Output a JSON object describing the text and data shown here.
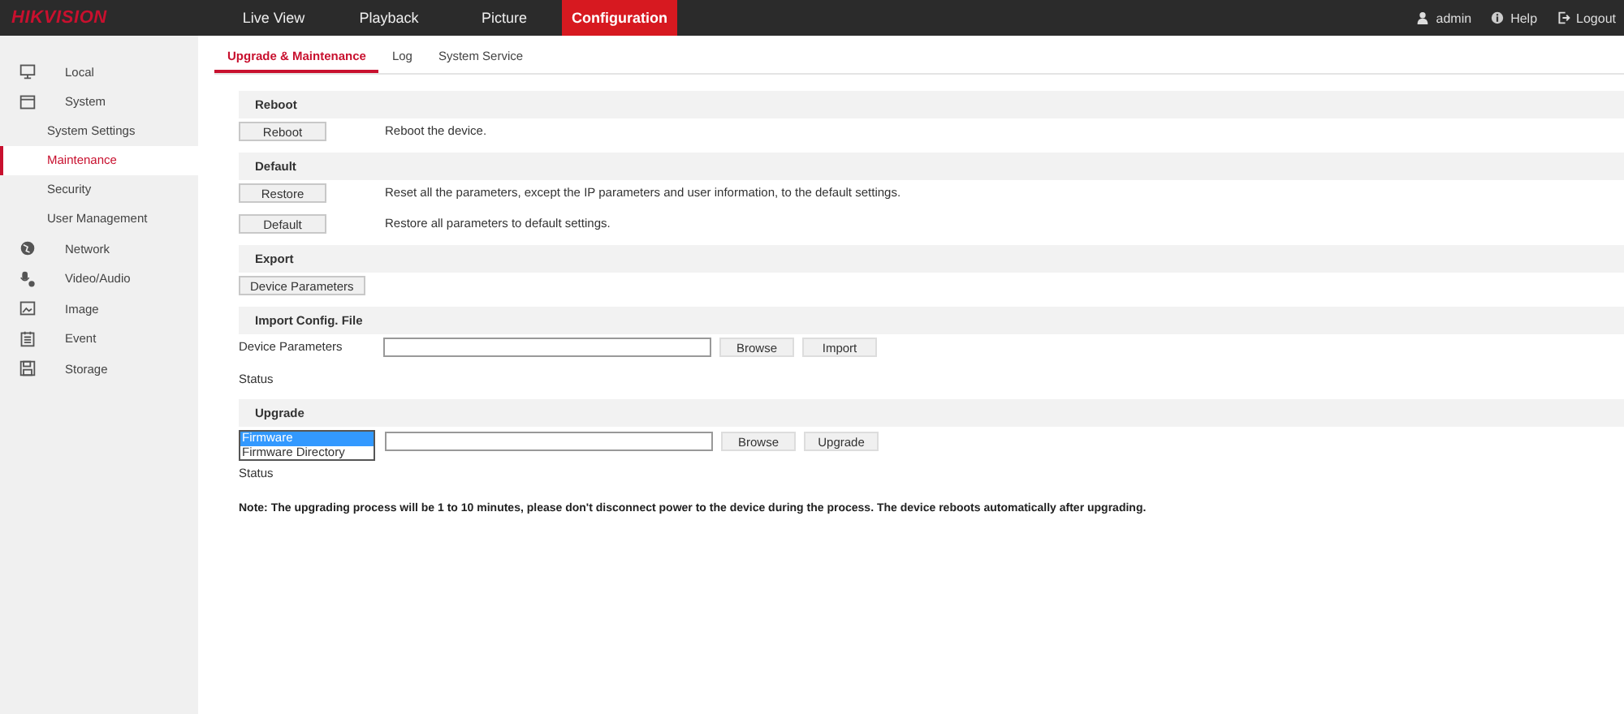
{
  "header": {
    "logo": "HIKVISION",
    "nav": [
      {
        "label": "Live View",
        "selected": false
      },
      {
        "label": "Playback",
        "selected": false
      },
      {
        "label": "Picture",
        "selected": false
      },
      {
        "label": "Configuration",
        "selected": true
      }
    ],
    "user_menu": [
      {
        "kind": "user",
        "label": "admin"
      },
      {
        "kind": "help",
        "label": "Help"
      },
      {
        "kind": "logout",
        "label": "Logout"
      }
    ]
  },
  "sidebar": {
    "items": [
      {
        "kind": "monitor",
        "label": "Local",
        "selected": false
      },
      {
        "kind": "system",
        "label": "System",
        "selected": false,
        "children": [
          {
            "label": "System Settings",
            "selected": false
          },
          {
            "label": "Maintenance",
            "selected": true
          },
          {
            "label": "Security",
            "selected": false
          },
          {
            "label": "User Management",
            "selected": false
          }
        ]
      },
      {
        "kind": "network",
        "label": "Network",
        "selected": false
      },
      {
        "kind": "video",
        "label": "Video/Audio",
        "selected": false
      },
      {
        "kind": "image",
        "label": "Image",
        "selected": false
      },
      {
        "kind": "event",
        "label": "Event",
        "selected": false
      },
      {
        "kind": "storage",
        "label": "Storage",
        "selected": false
      }
    ]
  },
  "tabs": [
    {
      "label": "Upgrade & Maintenance",
      "selected": true
    },
    {
      "label": "Log",
      "selected": false
    },
    {
      "label": "System Service",
      "selected": false
    }
  ],
  "sections": [
    {
      "title": "Reboot",
      "rows": [
        {
          "kind": "action",
          "button": "Reboot",
          "description": "Reboot the device."
        }
      ]
    },
    {
      "title": "Default",
      "rows": [
        {
          "kind": "action",
          "button": "Restore",
          "description": "Reset all the parameters, except the IP parameters and user information, to the default settings."
        },
        {
          "kind": "action",
          "button": "Default",
          "description": "Restore all parameters to default settings."
        }
      ]
    },
    {
      "title": "Export",
      "rows": [
        {
          "kind": "action",
          "button": "Device Parameters"
        }
      ]
    },
    {
      "title": "Import Config. File",
      "rows": [
        {
          "kind": "file",
          "label": "Device Parameters",
          "buttons": [
            "Browse",
            "Import"
          ]
        },
        {
          "kind": "status",
          "label": "Status"
        }
      ]
    },
    {
      "title": "Upgrade",
      "rows": [
        {
          "kind": "select_file",
          "options": [
            {
              "label": "Firmware",
              "selected": true
            },
            {
              "label": "Firmware Directory",
              "selected": false
            }
          ],
          "buttons": [
            "Browse",
            "Upgrade"
          ]
        },
        {
          "kind": "status",
          "label": "Status"
        },
        {
          "kind": "note",
          "text": "Note: The upgrading process will be 1 to 10 minutes, please don't disconnect power to the device during the process. The device reboots automatically after upgrading."
        }
      ]
    }
  ]
}
